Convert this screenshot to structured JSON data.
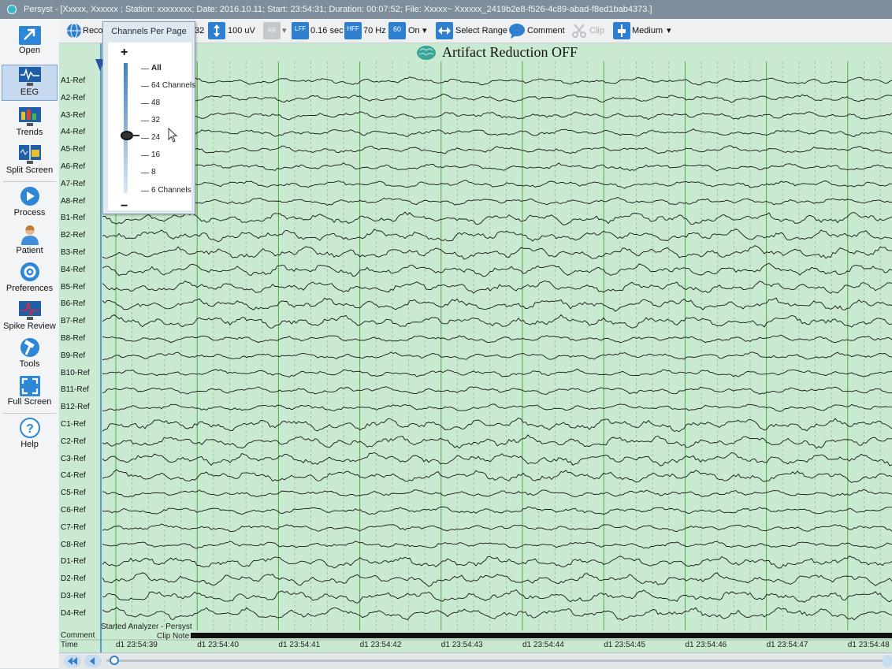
{
  "window": {
    "title": "Persyst - [Xxxxx, Xxxxxx ; Station: xxxxxxxx; Date: 2016.10.11; Start: 23:54:31; Duration: 00:07:52; File: Xxxxx~ Xxxxxx_2419b2e8-f526-4c89-abad-f8ed1bab4373.]"
  },
  "sidebar": {
    "items": [
      {
        "label": "Open",
        "icon": "folder-arrow-icon"
      },
      {
        "label": "EEG",
        "icon": "eeg-monitor-icon"
      },
      {
        "label": "Trends",
        "icon": "trends-chart-icon"
      },
      {
        "label": "Split Screen",
        "icon": "split-screen-icon"
      },
      {
        "label": "Process",
        "icon": "play-icon"
      },
      {
        "label": "Patient",
        "icon": "patient-icon"
      },
      {
        "label": "Preferences",
        "icon": "gear-icon"
      },
      {
        "label": "Spike Review",
        "icon": "spike-review-icon"
      },
      {
        "label": "Tools",
        "icon": "hammer-icon"
      },
      {
        "label": "Full Screen",
        "icon": "expand-icon"
      },
      {
        "label": "Help",
        "icon": "help-icon"
      }
    ]
  },
  "toolbar": {
    "recording_label": "Reco",
    "channels_value": "32",
    "sensitivity": "100 uV",
    "ar_badge": "AR",
    "lff_badge": "LFF",
    "lff_value": "0.16 sec",
    "hff_badge": "HFF",
    "hff_value": "70 Hz",
    "notch_badge": "60",
    "notch_value": "On",
    "select_range": "Select Range",
    "comment": "Comment",
    "clip": "Clip",
    "speed": "Medium"
  },
  "popup": {
    "title": "Channels Per Page",
    "plus": "+",
    "minus": "−",
    "options": [
      "All",
      "64 Channels",
      "48",
      "32",
      "24",
      "16",
      "8",
      "6 Channels"
    ],
    "selected": "32"
  },
  "main": {
    "artifact_status": "Artifact Reduction OFF",
    "channels": [
      "A1-Ref",
      "A2-Ref",
      "A3-Ref",
      "A4-Ref",
      "A5-Ref",
      "A6-Ref",
      "A7-Ref",
      "A8-Ref",
      "B1-Ref",
      "B2-Ref",
      "B3-Ref",
      "B4-Ref",
      "B5-Ref",
      "B6-Ref",
      "B7-Ref",
      "B8-Ref",
      "B9-Ref",
      "B10-Ref",
      "B11-Ref",
      "B12-Ref",
      "C1-Ref",
      "C2-Ref",
      "C3-Ref",
      "C4-Ref",
      "C5-Ref",
      "C6-Ref",
      "C7-Ref",
      "C8-Ref",
      "D1-Ref",
      "D2-Ref",
      "D3-Ref",
      "D4-Ref"
    ],
    "comment_label": "Comment",
    "time_label": "Time",
    "annotation": "Started Analyzer - Persyst",
    "clip_note": "Clip Note",
    "time_ticks": [
      "d1 23:54:39",
      "d1 23:54:40",
      "d1 23:54:41",
      "d1 23:54:42",
      "d1 23:54:43",
      "d1 23:54:44",
      "d1 23:54:45",
      "d1 23:54:46",
      "d1 23:54:47",
      "d1 23:54:48"
    ]
  },
  "colors": {
    "eeg_background": "#c9ead0",
    "trace": "#161616",
    "second_line": "#4fae45",
    "accent": "#2a7fd0"
  }
}
